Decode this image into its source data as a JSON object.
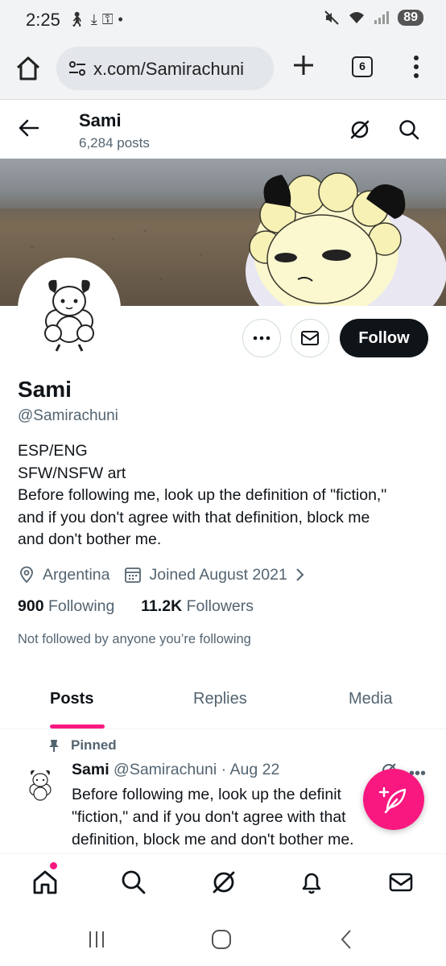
{
  "status_bar": {
    "time": "2:25",
    "notification_icons": [
      "walking-icon",
      "download-icon",
      "key-icon",
      "dot-icon"
    ],
    "right_icons": [
      "mute-icon",
      "wifi-icon",
      "signal-icon"
    ],
    "battery": "89"
  },
  "browser": {
    "url": "x.com/Samirachuni",
    "tab_count": "6"
  },
  "header": {
    "name": "Sami",
    "posts_count": "6,284 posts"
  },
  "profile": {
    "name": "Sami",
    "handle": "@Samirachuni",
    "bio_lines": [
      "ESP/ENG",
      "SFW/NSFW art",
      "Before following me, look up the definition of \"fiction,\"",
      "and if you don't agree with that definition, block me",
      "and don't bother me."
    ],
    "location": "Argentina",
    "joined": "Joined August 2021",
    "following_count": "900",
    "following_label": "Following",
    "followers_count": "11.2K",
    "followers_label": "Followers",
    "not_followed": "Not followed by anyone you’re following",
    "follow_label": "Follow"
  },
  "tabs": [
    {
      "label": "Posts",
      "active": true
    },
    {
      "label": "Replies",
      "active": false
    },
    {
      "label": "Media",
      "active": false
    }
  ],
  "pinned_post": {
    "pinned_label": "Pinned",
    "author": "Sami",
    "handle": "@Samirachuni",
    "date": "Aug 22",
    "text_lines": [
      "Before following me, look up the definit",
      "\"fiction,\" and if you don't agree with that",
      "definition, block me and don't bother me."
    ]
  },
  "colors": {
    "accent": "#f91880",
    "follow_button": "#0f1419",
    "secondary_text": "#536471"
  }
}
